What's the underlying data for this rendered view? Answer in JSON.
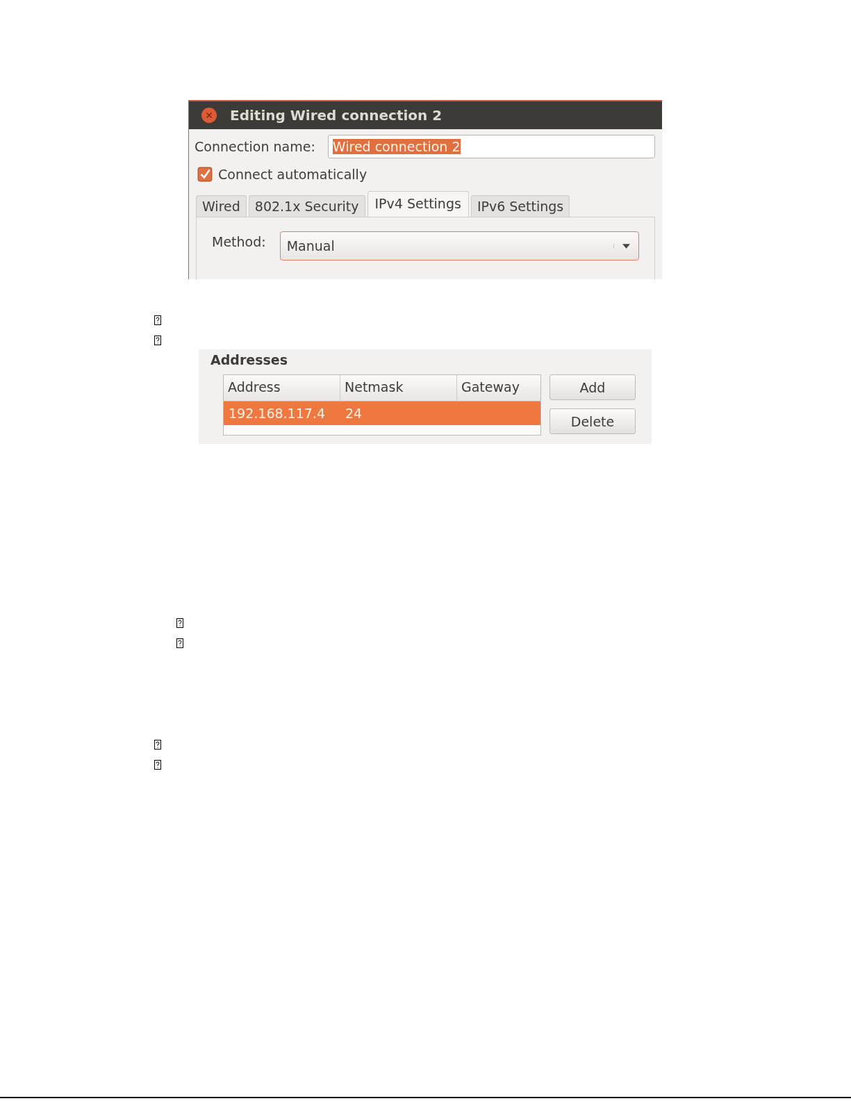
{
  "dialog": {
    "title": "Editing Wired connection 2",
    "connection_name": {
      "label": "Connection name:",
      "value": "Wired connection 2"
    },
    "connect_automatically": {
      "label": "Connect automatically",
      "checked": true
    },
    "tabs": [
      {
        "label": "Wired",
        "selected": false
      },
      {
        "label": "802.1x Security",
        "selected": false
      },
      {
        "label": "IPv4 Settings",
        "selected": true
      },
      {
        "label": "IPv6 Settings",
        "selected": false
      }
    ],
    "method": {
      "label": "Method:",
      "value": "Manual"
    }
  },
  "addresses": {
    "title": "Addresses",
    "columns": [
      "Address",
      "Netmask",
      "Gateway"
    ],
    "rows": [
      {
        "cells": [
          "192.168.117.4",
          "24",
          ""
        ],
        "selected": true
      }
    ],
    "buttons": [
      "Add",
      "Delete"
    ]
  }
}
